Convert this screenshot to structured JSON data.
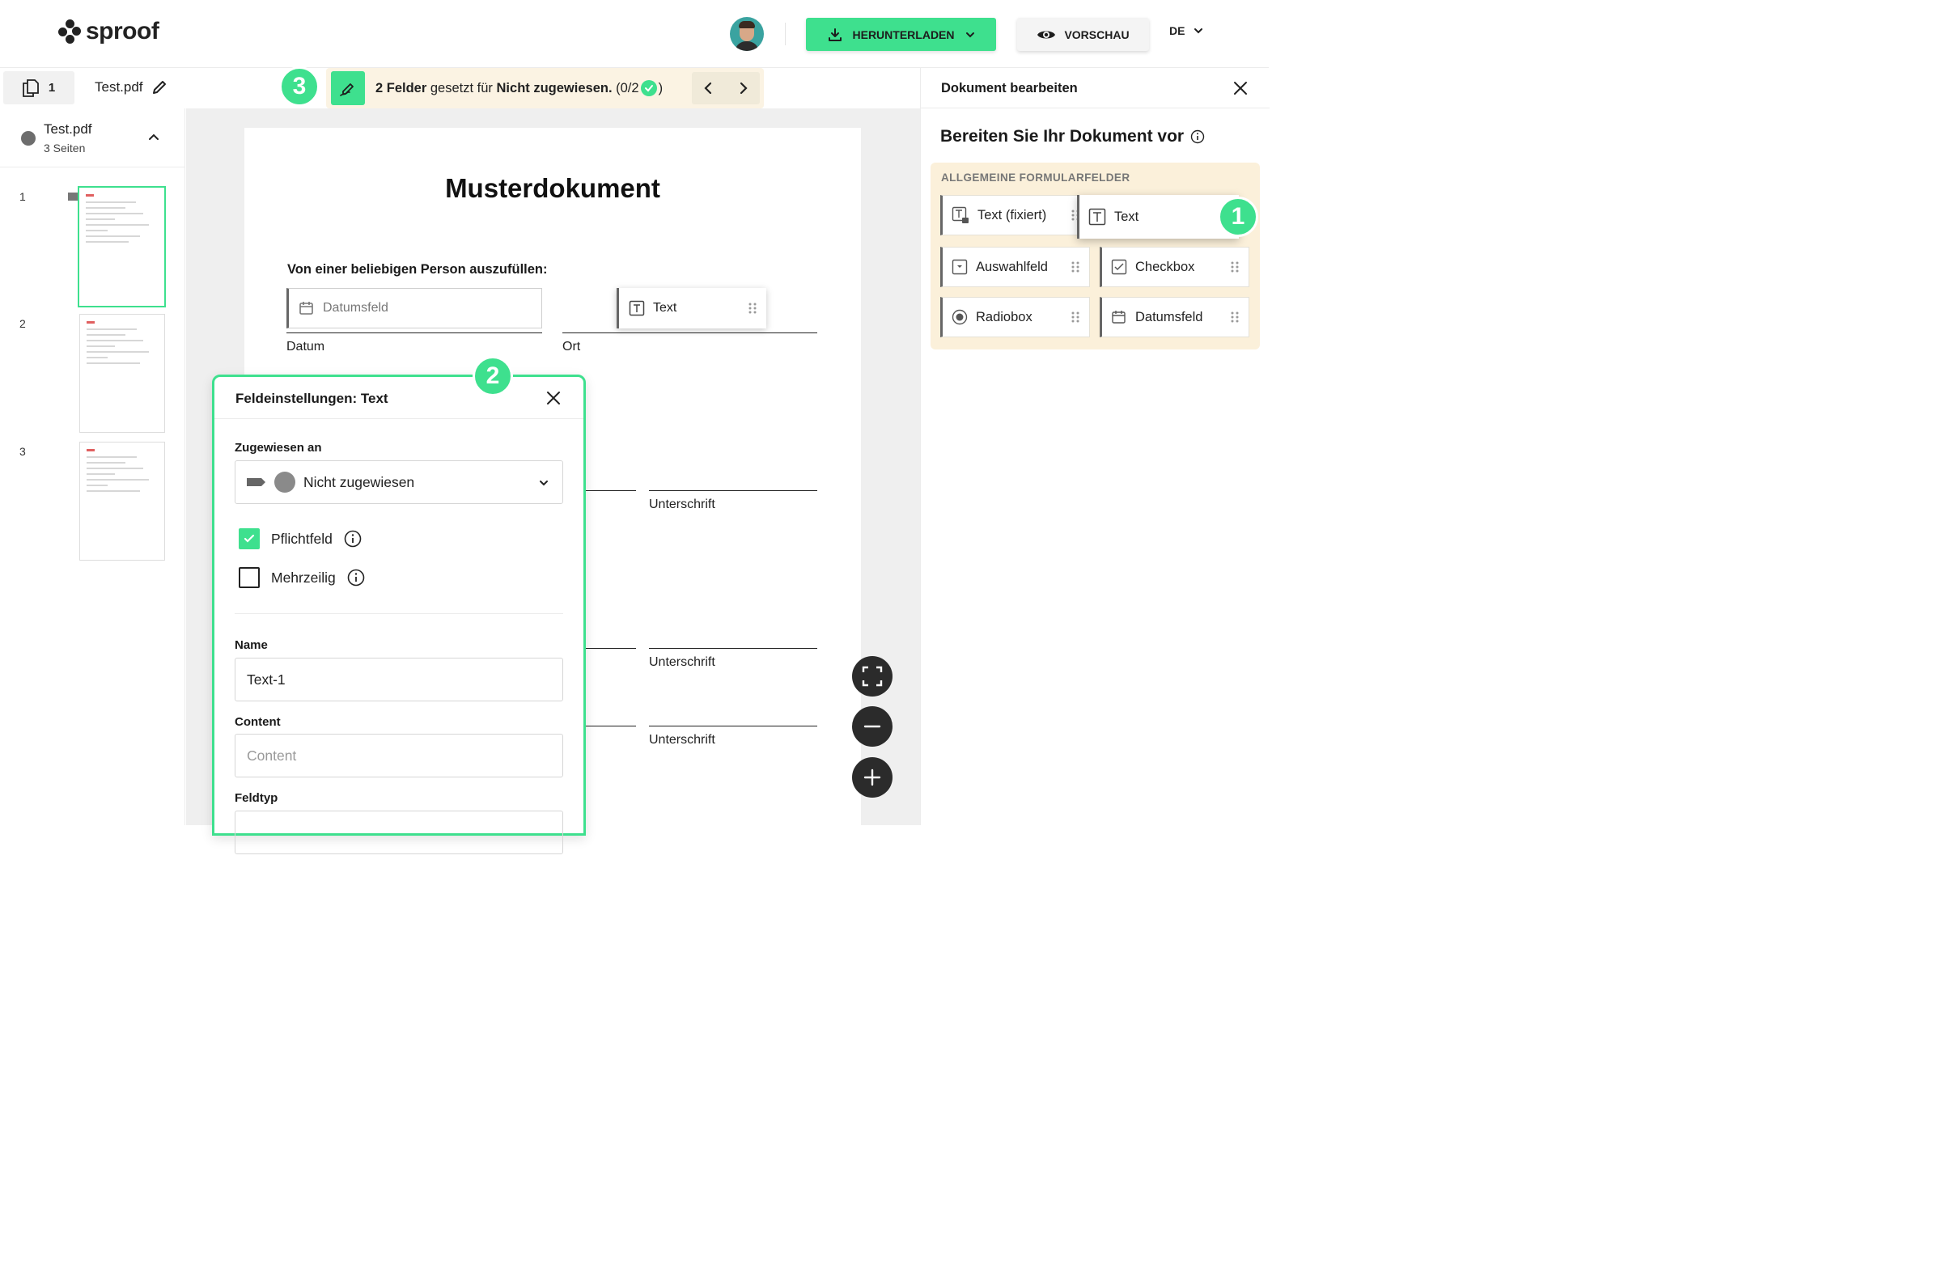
{
  "header": {
    "logo_text": "sproof",
    "download_label": "HERUNTERLADEN",
    "preview_label": "VORSCHAU",
    "language": "DE"
  },
  "toolbar": {
    "page_count": "1",
    "file_name": "Test.pdf",
    "status_count": "2 Felder",
    "status_mid": "gesetzt für",
    "status_assignee": "Nicht zugewiesen.",
    "status_progress_open": "(0/2",
    "status_progress_close": ")"
  },
  "steps": [
    "1",
    "2",
    "3"
  ],
  "sidebar": {
    "doc_title": "Test.pdf",
    "doc_pages": "3 Seiten",
    "thumbnails": [
      {
        "num": "1",
        "selected": true
      },
      {
        "num": "2",
        "selected": false
      },
      {
        "num": "3",
        "selected": false
      }
    ]
  },
  "document": {
    "heading": "Musterdokument",
    "instruction": "Von einer beliebigen Person auszufüllen:",
    "date_field_placeholder": "Datumsfeld",
    "text_field_label": "Text",
    "label_datum": "Datum",
    "label_ort": "Ort",
    "label_sig1": "Unterschrift",
    "label_sig2": "Unterschrift",
    "label_sig3": "Unterschrift"
  },
  "field_settings": {
    "title": "Feldeinstellungen: Text",
    "assigned_label": "Zugewiesen an",
    "assigned_value": "Nicht zugewiesen",
    "required_label": "Pflichtfeld",
    "required_checked": true,
    "multiline_label": "Mehrzeilig",
    "multiline_checked": false,
    "name_label": "Name",
    "name_value": "Text-1",
    "content_label": "Content",
    "content_placeholder": "Content",
    "fieldtype_label": "Feldtyp"
  },
  "right_panel": {
    "title": "Dokument bearbeiten",
    "subtitle": "Bereiten Sie Ihr Dokument vor",
    "section_label": "ALLGEMEINE FORMULARFELDER",
    "fields": {
      "text_fixed": "Text (fixiert)",
      "text": "Text",
      "select": "Auswahlfeld",
      "checkbox": "Checkbox",
      "radiobox": "Radiobox",
      "date": "Datumsfeld"
    }
  },
  "colors": {
    "accent": "#3ee08e",
    "status_bg": "#fbf3e3",
    "panel_bg": "#fbf0da",
    "dark_button": "#2b2b2b"
  },
  "icons": [
    "download-icon",
    "eye-icon",
    "chevron-down-icon",
    "pages-icon",
    "pencil-icon",
    "signature-icon",
    "chevron-left-icon",
    "chevron-right-icon",
    "chevron-up-icon",
    "close-icon",
    "calendar-icon",
    "text-field-icon",
    "grip-icon",
    "info-icon",
    "fullscreen-icon",
    "minus-icon",
    "plus-icon",
    "select-field-icon",
    "checkbox-icon",
    "radio-icon",
    "lock-text-icon"
  ]
}
